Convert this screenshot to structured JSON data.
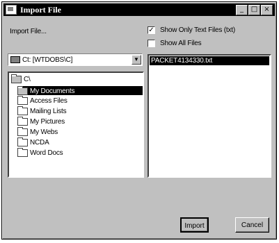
{
  "window": {
    "title": "Import File",
    "controls": {
      "minimize": "_",
      "maximize": "□",
      "close": "×"
    }
  },
  "import_label": "Import File...",
  "drive_combo": {
    "value": "Ct: [WTDOBS\\C]",
    "icon": "drive-icon"
  },
  "directory_tree": {
    "items": [
      {
        "label": "C\\",
        "icon": "folder-open-icon"
      },
      {
        "label": "My Documents",
        "icon": "folder-open-icon",
        "selected": true
      },
      {
        "label": "Access Files",
        "icon": "folder-icon"
      },
      {
        "label": "Mailing Lists",
        "icon": "folder-icon"
      },
      {
        "label": "My Pictures",
        "icon": "folder-icon"
      },
      {
        "label": "My Webs",
        "icon": "folder-icon"
      },
      {
        "label": "NCDA",
        "icon": "folder-icon"
      },
      {
        "label": "Word Docs",
        "icon": "folder-icon"
      }
    ]
  },
  "options": {
    "show_text_only": {
      "label": "Show Only Text Files (txt)",
      "checked": true,
      "mark": "✓"
    },
    "show_all": {
      "label": "Show All Files",
      "checked": false
    }
  },
  "file_list": {
    "selected_file": "PACKET4134330.txt"
  },
  "buttons": {
    "import": "Import",
    "cancel": "Cancel"
  }
}
